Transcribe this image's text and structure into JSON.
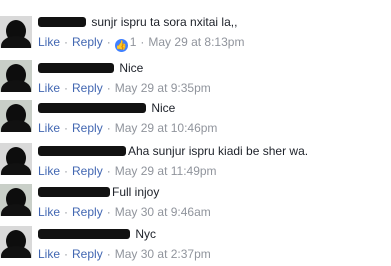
{
  "actions": {
    "like": "Like",
    "reply": "Reply",
    "dot": "·"
  },
  "comments": [
    {
      "text": "sunjr ispru ta sora nxitai la,,",
      "likes": "1",
      "time": "May 29 at 8:13pm"
    },
    {
      "text": "Nice",
      "time": "May 29 at 9:35pm"
    },
    {
      "text": "Nice",
      "time": "May 29 at 10:46pm"
    },
    {
      "text": "Aha sunjur ispru kiadi be sher wa.",
      "time": "May 29 at 11:49pm"
    },
    {
      "text": "Full injoy",
      "time": "May 30 at 9:46am"
    },
    {
      "text": "Nyc",
      "time": "May 30 at 2:37pm"
    }
  ],
  "icons": {
    "like_badge": "thumbs-up-icon"
  },
  "colors": {
    "link": "#4267b2",
    "meta": "#90949c",
    "like_badge": "#4080ff"
  }
}
